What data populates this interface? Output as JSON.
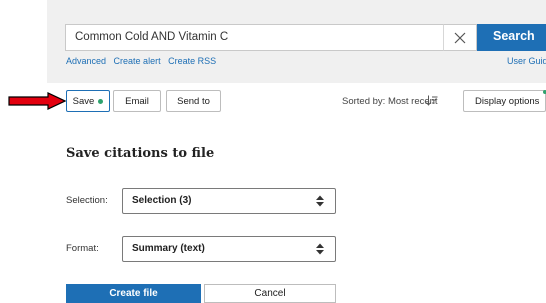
{
  "search": {
    "query": "Common Cold AND Vitamin C",
    "button_label": "Search",
    "links": [
      "Advanced",
      "Create alert",
      "Create RSS"
    ],
    "user_guide": "User Guid"
  },
  "actions": {
    "save": "Save",
    "email": "Email",
    "send_to": "Send to",
    "sorted_by": "Sorted by: Most recent",
    "display_options": "Display options"
  },
  "panel": {
    "title": "Save citations to file",
    "selection_label": "Selection:",
    "selection_value": "Selection (3)",
    "format_label": "Format:",
    "format_value": "Summary (text)",
    "create_button": "Create file",
    "cancel_button": "Cancel"
  },
  "colors": {
    "accent": "#1e6fb5",
    "indicator_dot": "#2ea26e",
    "annotation_arrow": "#e3000f"
  },
  "icons": [
    "clear-x-icon",
    "sort-descending-icon",
    "updown-caret-icon",
    "red-arrow-annotation"
  ]
}
